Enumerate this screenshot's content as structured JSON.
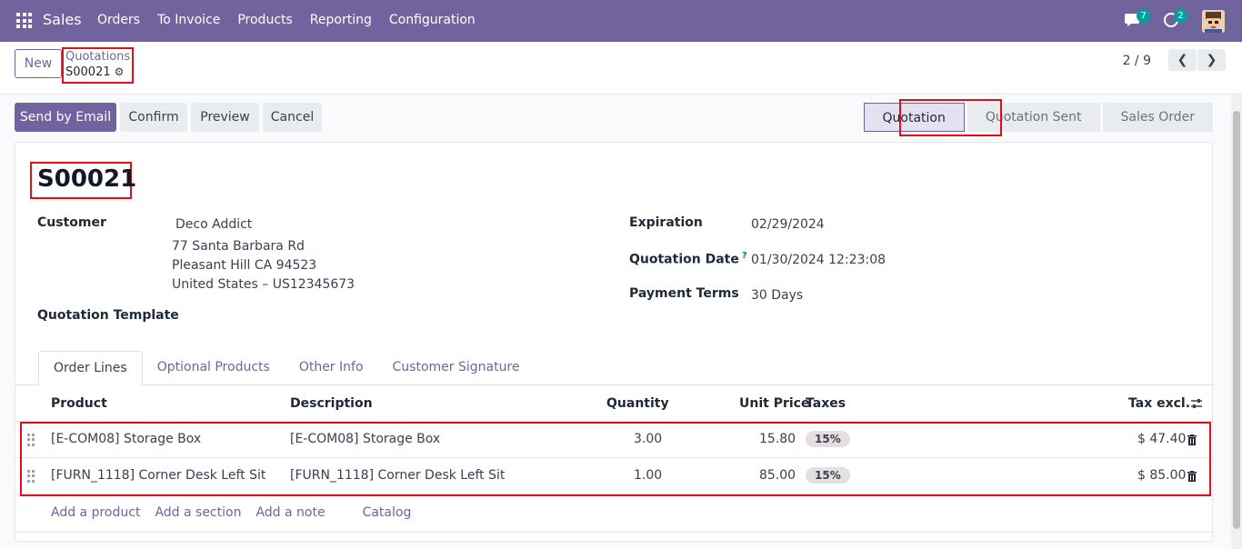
{
  "navbar": {
    "app_name": "Sales",
    "menu": [
      "Orders",
      "To Invoice",
      "Products",
      "Reporting",
      "Configuration"
    ],
    "chat_count": "7",
    "activity_count": "2"
  },
  "control": {
    "new_label": "New",
    "breadcrumb_parent": "Quotations",
    "breadcrumb_current": "S00021",
    "pager": "2 / 9"
  },
  "statusbar": {
    "buttons": [
      "Send by Email",
      "Confirm",
      "Preview",
      "Cancel"
    ],
    "stages": [
      "Quotation",
      "Quotation Sent",
      "Sales Order"
    ]
  },
  "form": {
    "title": "S00021",
    "customer_label": "Customer",
    "customer_name": "Deco Addict",
    "address_line1": "77 Santa Barbara Rd",
    "address_line2": "Pleasant Hill CA 94523",
    "address_line3": "United States – US12345673",
    "template_label": "Quotation Template",
    "expiration_label": "Expiration",
    "expiration_value": "02/29/2024",
    "quotation_date_label": "Quotation Date",
    "quotation_date_help": "?",
    "quotation_date_value": "01/30/2024 12:23:08",
    "payment_terms_label": "Payment Terms",
    "payment_terms_value": "30 Days"
  },
  "tabs": [
    "Order Lines",
    "Optional Products",
    "Other Info",
    "Customer Signature"
  ],
  "table": {
    "headers": {
      "product": "Product",
      "description": "Description",
      "quantity": "Quantity",
      "unit_price": "Unit Price",
      "taxes": "Taxes",
      "tax_excl": "Tax excl."
    },
    "rows": [
      {
        "product": "[E-COM08] Storage Box",
        "description": "[E-COM08] Storage Box",
        "quantity": "3.00",
        "unit_price": "15.80",
        "tax": "15%",
        "subtotal": "$ 47.40"
      },
      {
        "product": "[FURN_1118] Corner Desk Left Sit",
        "description": "[FURN_1118] Corner Desk Left Sit",
        "quantity": "1.00",
        "unit_price": "85.00",
        "tax": "15%",
        "subtotal": "$ 85.00"
      }
    ],
    "add_links": [
      "Add a product",
      "Add a section",
      "Add a note",
      "Catalog"
    ]
  }
}
